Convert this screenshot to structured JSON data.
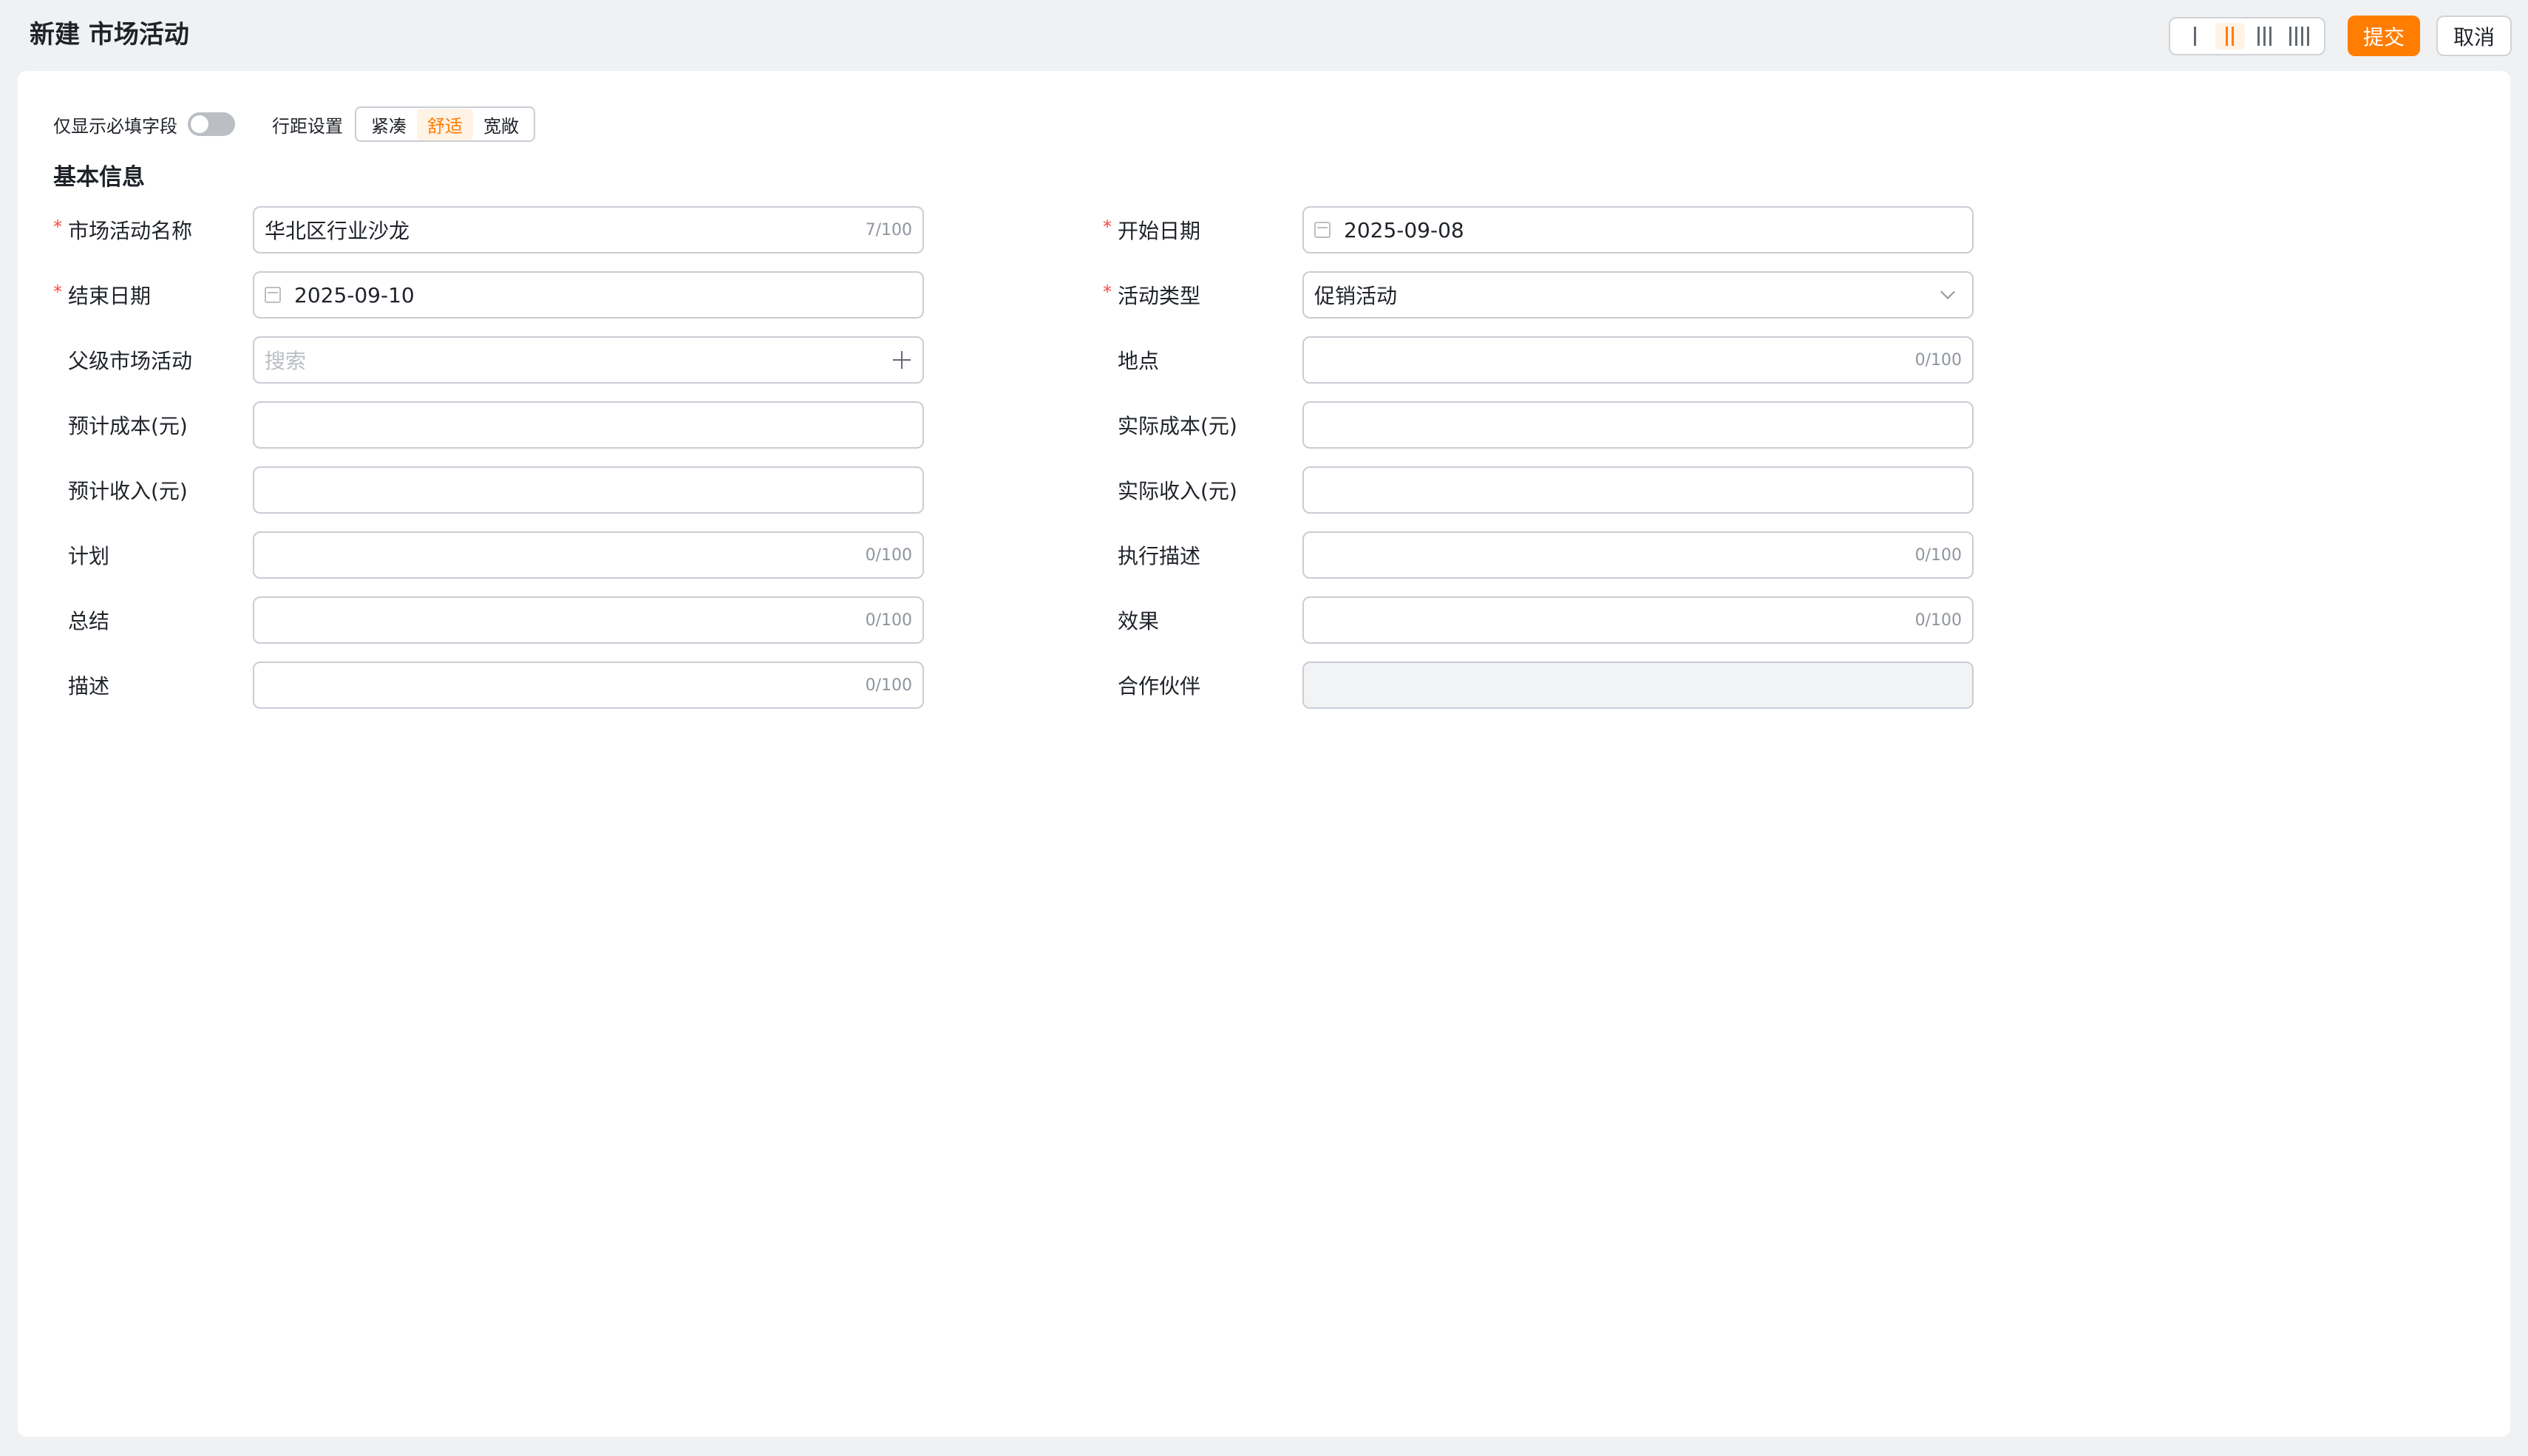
{
  "header": {
    "title": "新建 市场活动",
    "submit_label": "提交",
    "cancel_label": "取消",
    "column_layouts": [
      "1-column",
      "2-column",
      "3-column",
      "4-column"
    ],
    "active_column_layout": "2-column"
  },
  "toolbar": {
    "required_only_label": "仅显示必填字段",
    "required_only_enabled": false,
    "spacing_label": "行距设置",
    "spacing_options": [
      "紧凑",
      "舒适",
      "宽敞"
    ],
    "spacing_selected": "舒适"
  },
  "section": {
    "title": "基本信息"
  },
  "fields": {
    "name": {
      "label": "市场活动名称",
      "required": true,
      "value": "华北区行业沙龙",
      "counter": "7/100"
    },
    "start_date": {
      "label": "开始日期",
      "required": true,
      "value": "2025-09-08",
      "icon": "calendar-icon"
    },
    "end_date": {
      "label": "结束日期",
      "required": true,
      "value": "2025-09-10",
      "icon": "calendar-icon"
    },
    "activity_type": {
      "label": "活动类型",
      "required": true,
      "value": "促销活动",
      "icon": "chevron-down-icon"
    },
    "parent": {
      "label": "父级市场活动",
      "placeholder": "搜索",
      "icon": "plus-icon"
    },
    "location": {
      "label": "地点",
      "counter": "0/100"
    },
    "budget_cost": {
      "label": "预计成本(元)"
    },
    "actual_cost": {
      "label": "实际成本(元)"
    },
    "expected_revenue": {
      "label": "预计收入(元)"
    },
    "actual_revenue": {
      "label": "实际收入(元)"
    },
    "plan": {
      "label": "计划",
      "counter": "0/100"
    },
    "execution_desc": {
      "label": "执行描述",
      "counter": "0/100"
    },
    "summary": {
      "label": "总结",
      "counter": "0/100"
    },
    "effect": {
      "label": "效果",
      "counter": "0/100"
    },
    "description": {
      "label": "描述",
      "counter": "0/100"
    },
    "partner": {
      "label": "合作伙伴",
      "disabled": true
    }
  },
  "colors": {
    "accent": "#ff7d00",
    "required": "#f54a45",
    "border": "#c9cdd4"
  }
}
